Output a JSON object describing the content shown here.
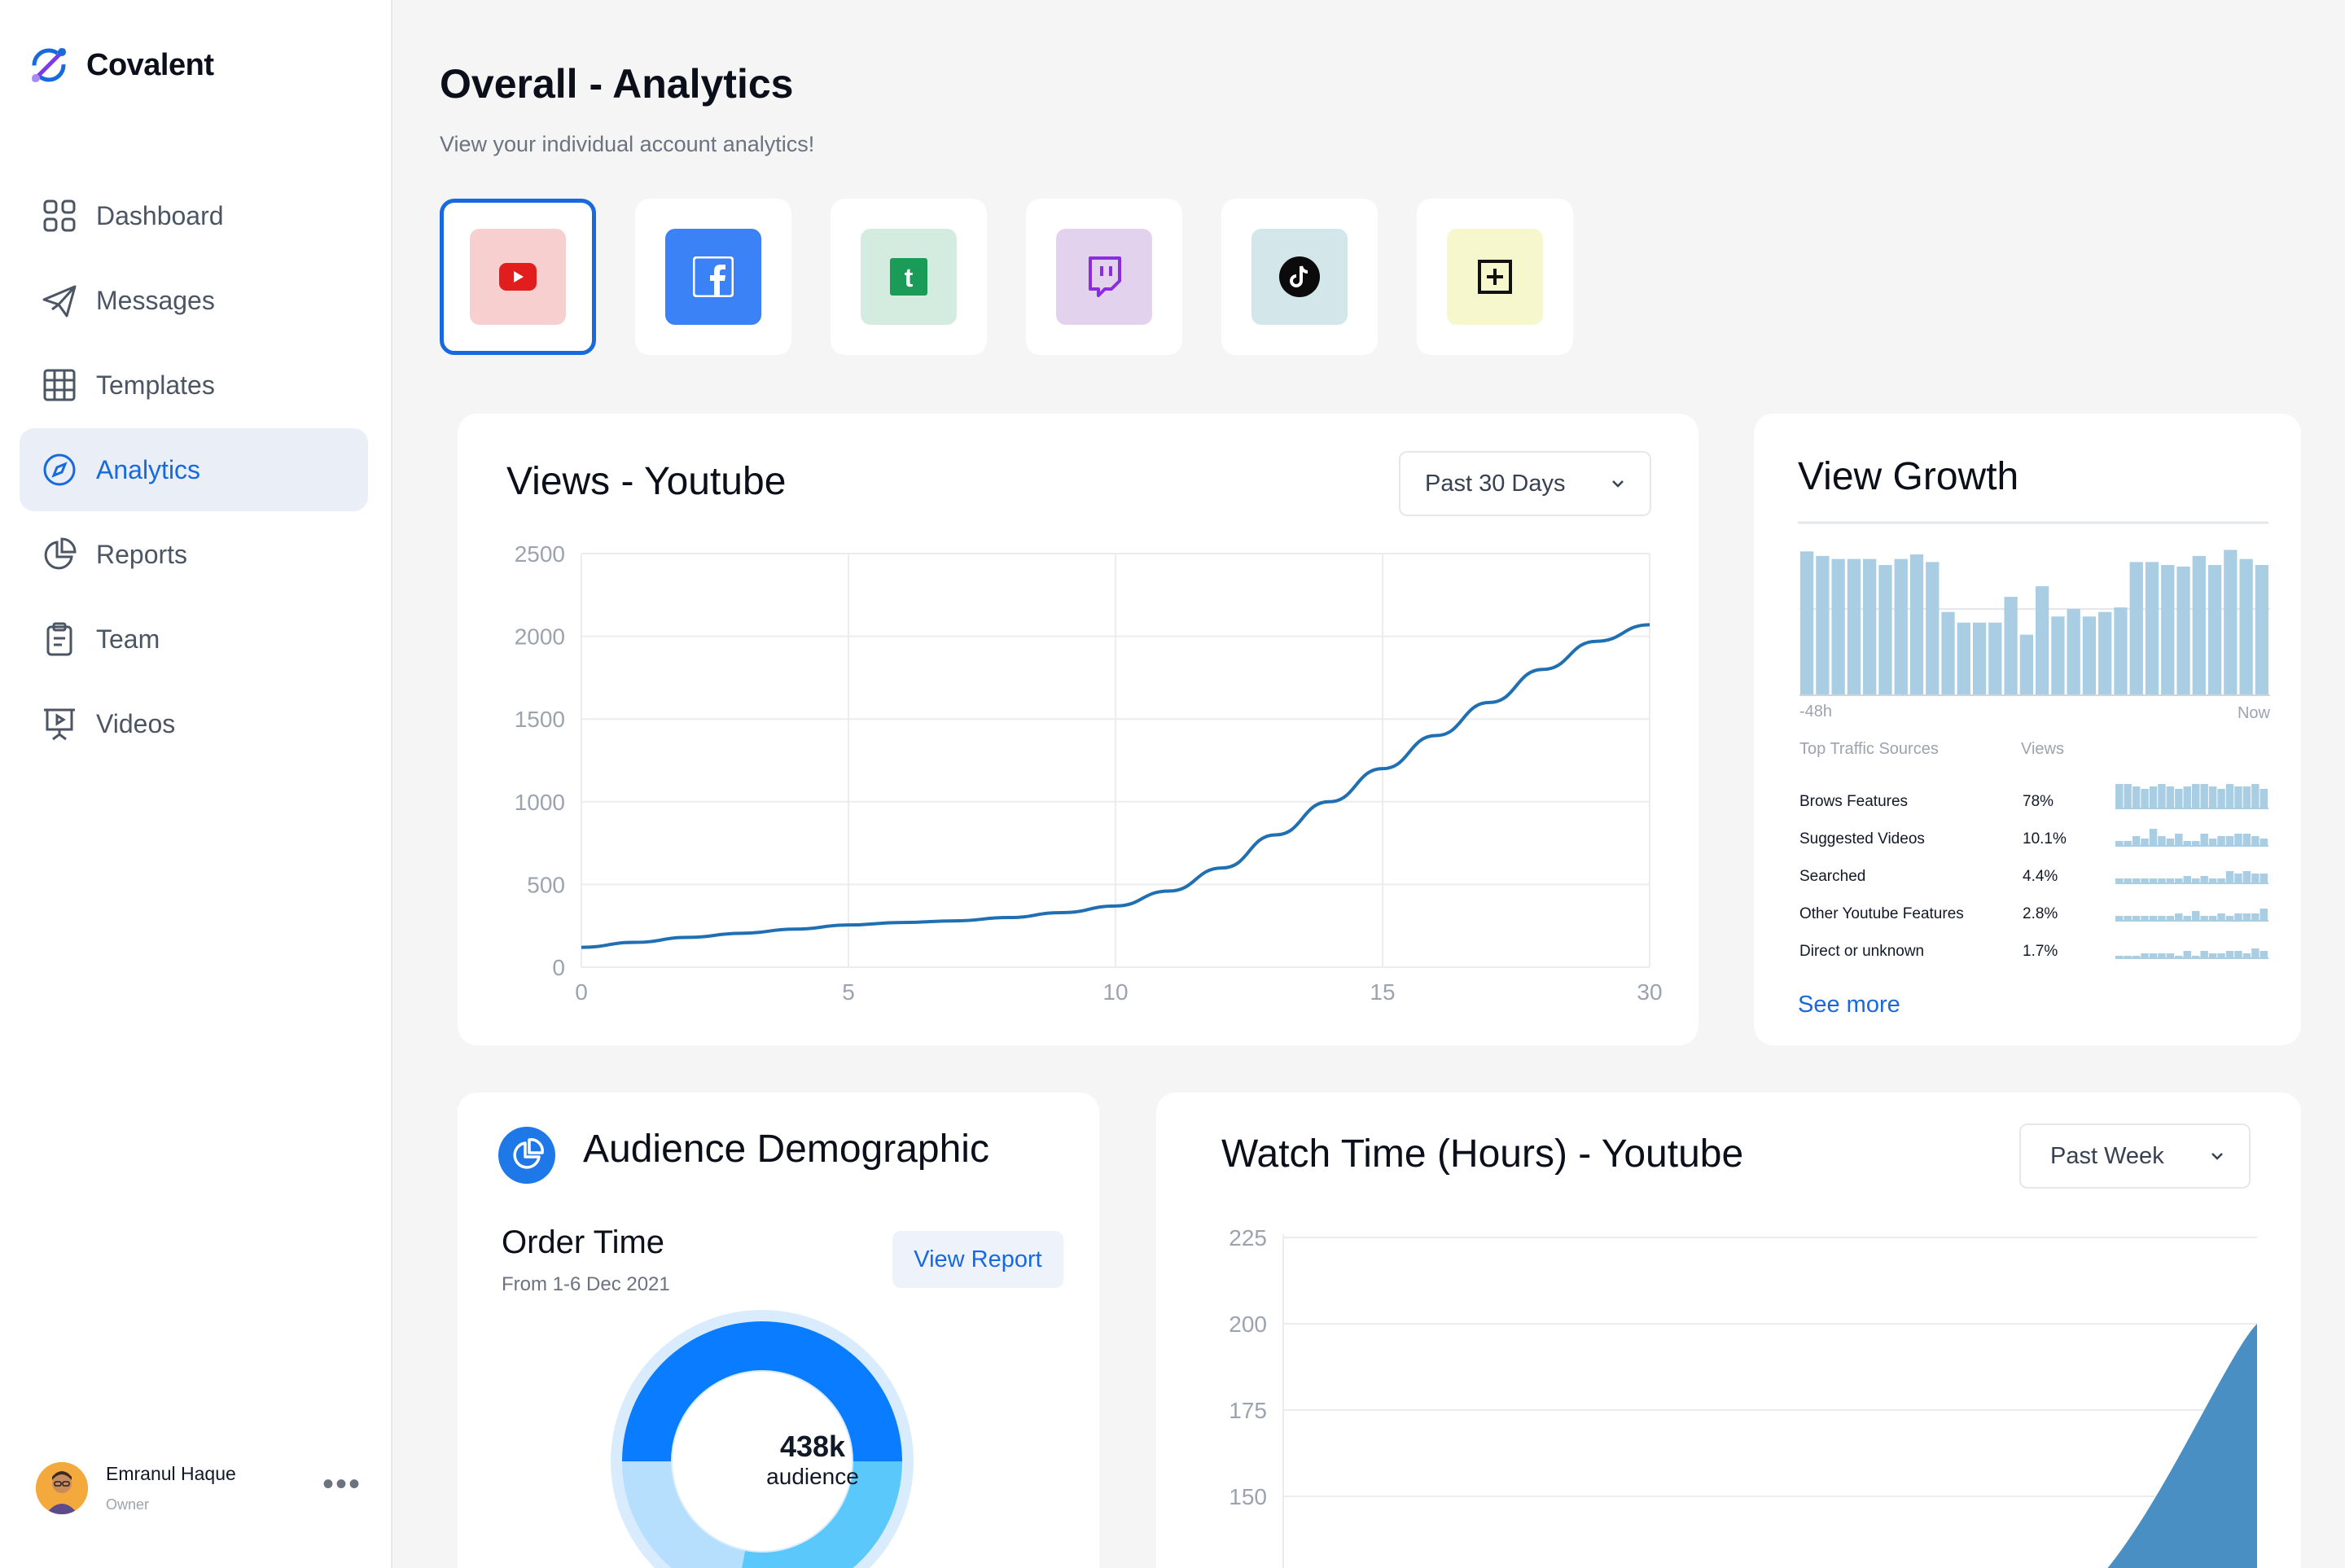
{
  "brand": {
    "name": "Covalent"
  },
  "sidebar": {
    "items": [
      {
        "label": "Dashboard",
        "icon": "grid-icon",
        "active": false
      },
      {
        "label": "Messages",
        "icon": "send-icon",
        "active": false
      },
      {
        "label": "Templates",
        "icon": "table-icon",
        "active": false
      },
      {
        "label": "Analytics",
        "icon": "compass-icon",
        "active": true
      },
      {
        "label": "Reports",
        "icon": "pie-icon",
        "active": false
      },
      {
        "label": "Team",
        "icon": "clipboard-icon",
        "active": false
      },
      {
        "label": "Videos",
        "icon": "presentation-icon",
        "active": false
      }
    ],
    "user": {
      "name": "Emranul Haque",
      "role": "Owner",
      "menu": "•••"
    }
  },
  "header": {
    "title": "Overall - Analytics",
    "subtitle": "View your individual account analytics!"
  },
  "platforms": [
    {
      "name": "youtube-icon",
      "bg": "#f8cfcf",
      "selected": true
    },
    {
      "name": "facebook-icon",
      "bg": "#3b82f6",
      "selected": false
    },
    {
      "name": "tumblr-icon",
      "bg": "#d3ecdf",
      "selected": false
    },
    {
      "name": "twitch-icon",
      "bg": "#e2d2ee",
      "selected": false
    },
    {
      "name": "tiktok-icon",
      "bg": "#d3e6ea",
      "selected": false
    },
    {
      "name": "add-icon",
      "bg": "#f6f7cd",
      "selected": false
    }
  ],
  "views_card": {
    "title": "Views - Youtube",
    "range": "Past 30 Days"
  },
  "growth_card": {
    "title": "View Growth",
    "start_label": "-48h",
    "end_label": "Now",
    "col_source": "Top Traffic Sources",
    "col_views": "Views",
    "rows": [
      {
        "label": "Brows Features",
        "value": "78%"
      },
      {
        "label": "Suggested Videos",
        "value": "10.1%"
      },
      {
        "label": "Searched",
        "value": "4.4%"
      },
      {
        "label": "Other Youtube Features",
        "value": "2.8%"
      },
      {
        "label": "Direct or unknown",
        "value": "1.7%"
      }
    ],
    "see_more": "See more"
  },
  "audience_card": {
    "title": "Audience Demographic",
    "subtitle": "Order Time",
    "date_range": "From 1-6 Dec 2021",
    "action": "View Report",
    "center_value": "438k",
    "center_label": "audience"
  },
  "watch_card": {
    "title": "Watch Time (Hours) - Youtube",
    "range": "Past Week"
  },
  "chart_data": [
    {
      "type": "line",
      "title": "Views - Youtube",
      "x_ticks": [
        "0",
        "5",
        "10",
        "15",
        "30"
      ],
      "y_ticks": [
        "0",
        "500",
        "1000",
        "1500",
        "2000",
        "2500"
      ],
      "ylim": [
        0,
        2500
      ],
      "grid": true,
      "series": [
        {
          "x": [
            0,
            1,
            2,
            3,
            4,
            5,
            6,
            7,
            8,
            9,
            10,
            11,
            12,
            13,
            14,
            15,
            16,
            17,
            18,
            19,
            20
          ],
          "y": [
            120,
            150,
            180,
            205,
            230,
            255,
            270,
            280,
            300,
            330,
            370,
            460,
            600,
            800,
            1000,
            1200,
            1400,
            1600,
            1800,
            1970,
            2070
          ]
        }
      ]
    },
    {
      "type": "bar",
      "title": "View Growth",
      "values": [
        95,
        92,
        90,
        90,
        90,
        86,
        90,
        93,
        88,
        55,
        48,
        48,
        48,
        65,
        40,
        72,
        52,
        57,
        52,
        55,
        58,
        88,
        88,
        86,
        85,
        92,
        86,
        96,
        90,
        86
      ]
    },
    {
      "type": "bar",
      "title": "Top Traffic Sources sparklines",
      "series": [
        {
          "name": "Brows Features",
          "values": [
            10,
            10,
            9,
            8,
            9,
            10,
            9,
            8,
            9,
            10,
            10,
            9,
            8,
            10,
            9,
            9,
            10,
            8
          ]
        },
        {
          "name": "Suggested Videos",
          "values": [
            2,
            2,
            4,
            3,
            7,
            4,
            3,
            5,
            2,
            2,
            5,
            3,
            4,
            4,
            5,
            5,
            4,
            3
          ]
        },
        {
          "name": "Searched",
          "values": [
            2,
            2,
            2,
            2,
            2,
            2,
            2,
            2,
            3,
            2,
            3,
            2,
            2,
            5,
            4,
            5,
            4,
            4
          ]
        },
        {
          "name": "Other Youtube Features",
          "values": [
            2,
            2,
            2,
            2,
            2,
            2,
            2,
            3,
            2,
            4,
            2,
            2,
            3,
            2,
            3,
            3,
            3,
            5
          ]
        },
        {
          "name": "Direct or unknown",
          "values": [
            1,
            1,
            1,
            2,
            2,
            2,
            2,
            1,
            3,
            1,
            3,
            2,
            2,
            3,
            3,
            2,
            4,
            3
          ]
        }
      ]
    },
    {
      "type": "pie",
      "title": "Order Time",
      "series": [
        {
          "name": "segment-a",
          "values": [
            50
          ]
        },
        {
          "name": "segment-b",
          "values": [
            28
          ]
        },
        {
          "name": "segment-c",
          "values": [
            22
          ]
        }
      ],
      "colors": [
        "#0a7cff",
        "#5ac8fa",
        "#b5dffc"
      ]
    },
    {
      "type": "area",
      "title": "Watch Time (Hours) - Youtube",
      "y_ticks": [
        "150",
        "175",
        "200",
        "225"
      ],
      "ylim": [
        140,
        225
      ],
      "series": [
        {
          "x": [
            0,
            1,
            2,
            3,
            4,
            5,
            6
          ],
          "y": [
            100,
            100,
            100,
            100,
            115,
            150,
            200
          ]
        }
      ]
    }
  ],
  "colors": {
    "accent": "#1769e0",
    "line": "#1f6fb2",
    "bar": "#a9cde3",
    "area": "#4a8fc4"
  }
}
